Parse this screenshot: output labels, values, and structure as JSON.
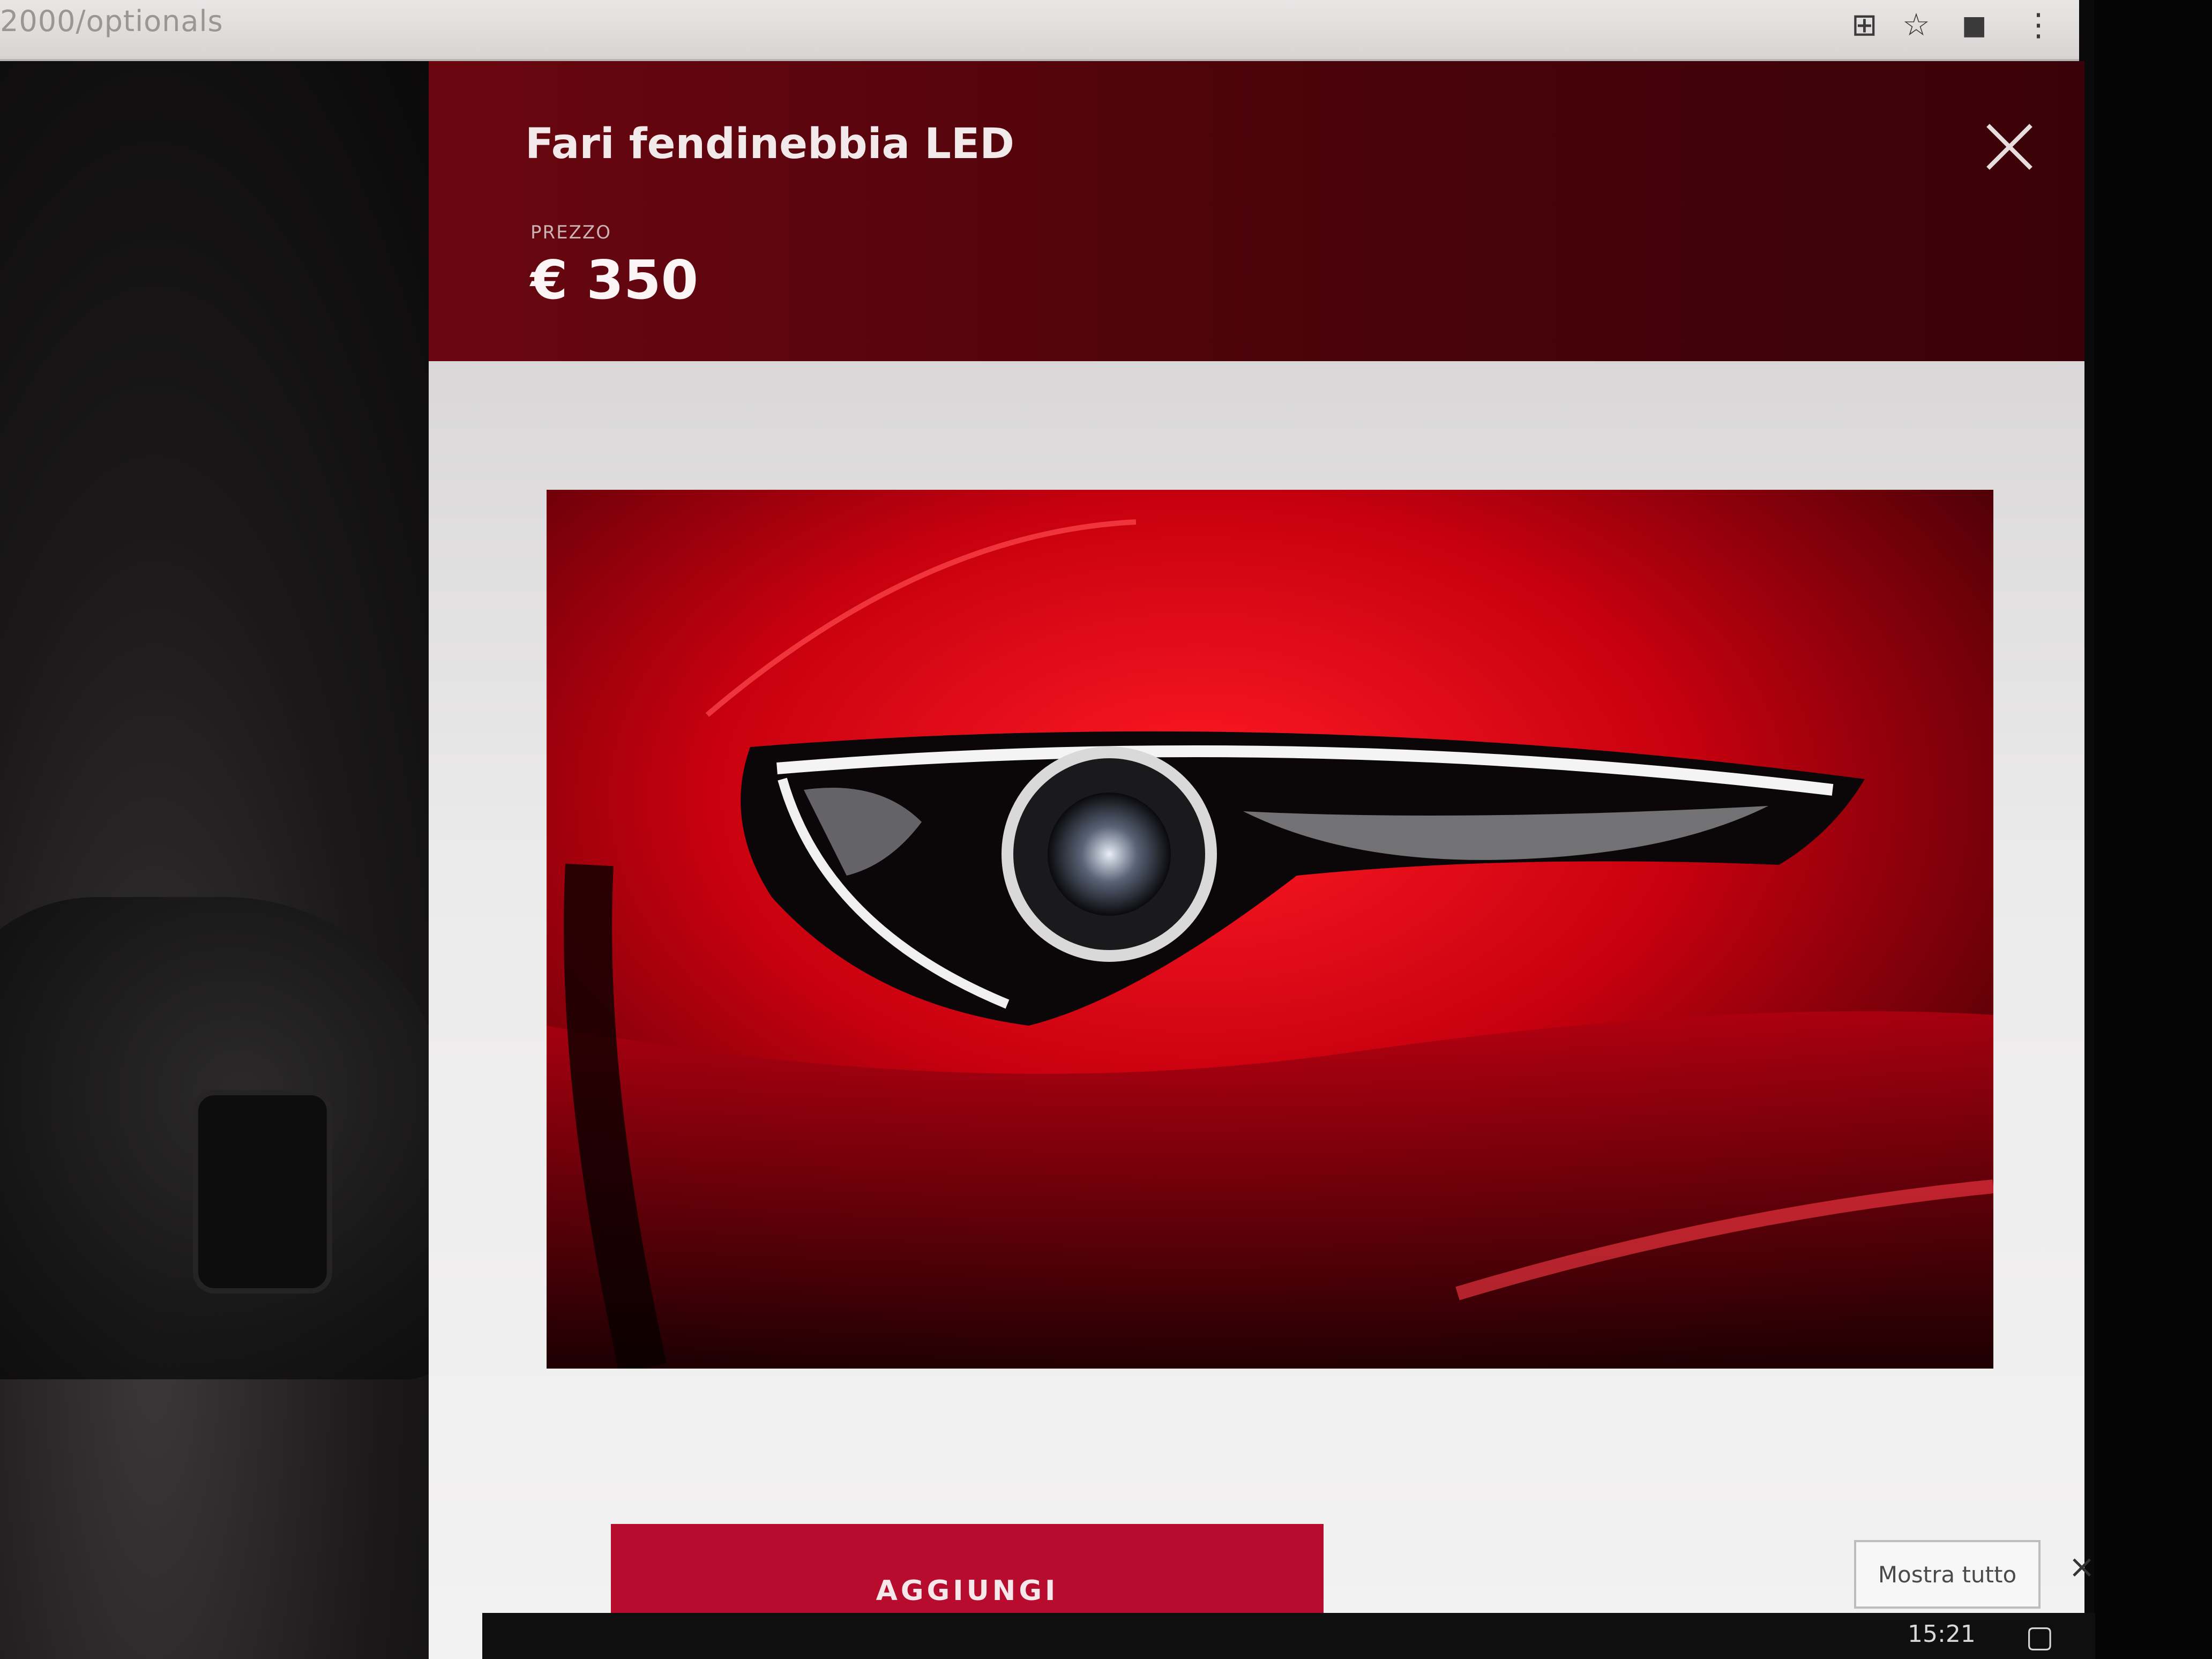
{
  "browser": {
    "url": "2000/optionals",
    "icons": [
      "translate-icon",
      "star-icon",
      "profile-icon",
      "menu-icon"
    ]
  },
  "modal": {
    "title": "Fari fendinebbia LED",
    "price_label": "PREZZO",
    "price_value": "€ 350",
    "close_icon": "close-icon",
    "image": "red-car-headlight-photo",
    "add_button_label": "AGGIUNGI"
  },
  "banner": {
    "show_all_label": "Mostra tutto",
    "close_label": "×"
  },
  "taskbar": {
    "clock": "15:21"
  },
  "colors": {
    "header_bg": "#5a0410",
    "accent": "#b80c2e",
    "body_bg": "#efeeee"
  }
}
